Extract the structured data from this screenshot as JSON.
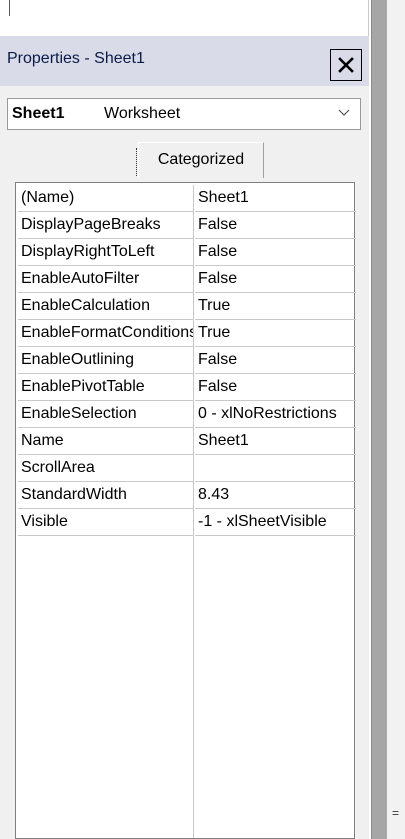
{
  "panel": {
    "title": "Properties - Sheet1",
    "object_dropdown": {
      "name": "Sheet1",
      "type": "Worksheet"
    },
    "tabs": {
      "categorized": "Categorized"
    },
    "properties": [
      {
        "name": "(Name)",
        "value": "Sheet1"
      },
      {
        "name": "DisplayPageBreaks",
        "value": "False"
      },
      {
        "name": "DisplayRightToLeft",
        "value": "False"
      },
      {
        "name": "EnableAutoFilter",
        "value": "False"
      },
      {
        "name": "EnableCalculation",
        "value": "True"
      },
      {
        "name": "EnableFormatConditionsCalculation",
        "value": "True"
      },
      {
        "name": "EnableOutlining",
        "value": "False"
      },
      {
        "name": "EnablePivotTable",
        "value": "False"
      },
      {
        "name": "EnableSelection",
        "value": "0 - xlNoRestrictions"
      },
      {
        "name": "Name",
        "value": "Sheet1"
      },
      {
        "name": "ScrollArea",
        "value": ""
      },
      {
        "name": "StandardWidth",
        "value": "8.43"
      },
      {
        "name": "Visible",
        "value": "-1 - xlSheetVisible"
      }
    ]
  },
  "right_glyph": "="
}
